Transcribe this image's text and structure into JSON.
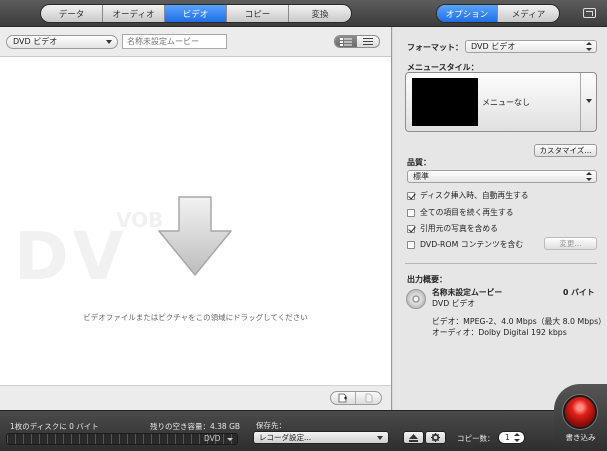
{
  "toolbar": {
    "main_tabs": [
      "データ",
      "オーディオ",
      "ビデオ",
      "コピー",
      "変換"
    ],
    "active_main_tab": "ビデオ",
    "right_tabs": [
      "オプション",
      "メディア"
    ],
    "active_right_tab": "オプション"
  },
  "left": {
    "format_select": "DVD ビデオ",
    "title_placeholder": "名称未設定ムービー",
    "watermark_big": "DV",
    "watermark_small": "VOB",
    "drop_hint": "ビデオファイルまたはピクチャをこの領域にドラッグしてください"
  },
  "options": {
    "format_label": "フォーマット：",
    "format_value": "DVD ビデオ",
    "menu_style_label": "メニュースタイル：",
    "menu_style_value": "メニューなし",
    "customize_button": "カスタマイズ...",
    "quality_label": "品質：",
    "quality_value": "標準",
    "checkboxes": [
      {
        "label": "ディスク挿入時、自動再生する",
        "checked": true
      },
      {
        "label": "全ての項目を続く再生する",
        "checked": false
      },
      {
        "label": "引用元の写真を含める",
        "checked": true
      },
      {
        "label": "DVD-ROM コンテンツを含む",
        "checked": false
      }
    ],
    "change_button": "変更...",
    "summary_label": "出力概要：",
    "summary_title": "名称未設定ムービー",
    "summary_size": "0 バイト",
    "summary_format": "DVD ビデオ",
    "summary_video": "ビデオ：MPEG-2、4.0 Mbps（最大 8.0 Mbps）",
    "summary_audio": "オーディオ：Dolby Digital 192 kbps"
  },
  "bottom": {
    "disc_info": "1枚のディスクに 0 バイト",
    "free_space": "残りの空き容量：4.38 GB",
    "disc_type": "DVD",
    "destination_label": "保存先：",
    "recorder_select": "レコーダ設定...",
    "copies_label": "コピー数：",
    "copies_value": "1",
    "burn_label": "書き込み"
  }
}
